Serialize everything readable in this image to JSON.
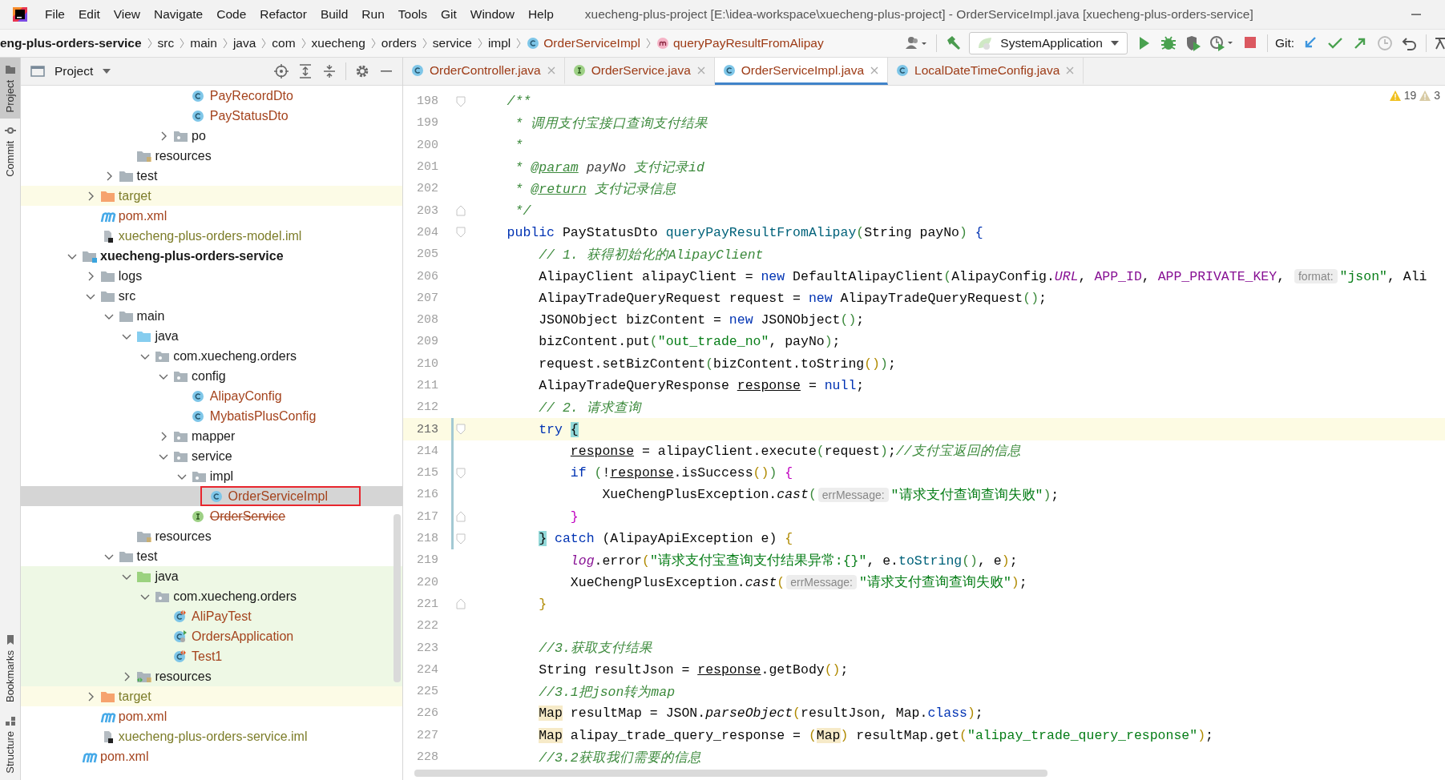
{
  "title_bar": {
    "menu": [
      "File",
      "Edit",
      "View",
      "Navigate",
      "Code",
      "Refactor",
      "Build",
      "Run",
      "Tools",
      "Git",
      "Window",
      "Help"
    ],
    "title": "xuecheng-plus-project [E:\\idea-workspace\\xuecheng-plus-project] - OrderServiceImpl.java [xuecheng-plus-orders-service]"
  },
  "breadcrumbs": [
    {
      "label": "eng-plus-orders-service",
      "kind": "module"
    },
    {
      "label": "src",
      "kind": "folder"
    },
    {
      "label": "main",
      "kind": "folder"
    },
    {
      "label": "java",
      "kind": "folder"
    },
    {
      "label": "com",
      "kind": "folder"
    },
    {
      "label": "xuecheng",
      "kind": "folder"
    },
    {
      "label": "orders",
      "kind": "folder"
    },
    {
      "label": "service",
      "kind": "folder"
    },
    {
      "label": "impl",
      "kind": "folder"
    },
    {
      "label": "OrderServiceImpl",
      "kind": "class"
    },
    {
      "label": "queryPayResultFromAlipay",
      "kind": "method"
    }
  ],
  "toolbar": {
    "run_config": "SystemApplication",
    "git_label": "Git:"
  },
  "tool_strip": {
    "top": [
      {
        "label": "Project",
        "selected": true
      },
      {
        "label": "Commit",
        "selected": false
      }
    ],
    "bottom": [
      {
        "label": "Bookmarks",
        "selected": false
      },
      {
        "label": "Structure",
        "selected": false
      }
    ]
  },
  "project": {
    "title": "Project",
    "tree": [
      {
        "children": [
          {
            "children": [
              {
                "children": [
                  {
                    "children": [
                      {
                        "children": [
                          {
                            "children": [
                              {
                                "label": "PayRecordDto",
                                "kind": "class",
                                "color": "#a4431d",
                                "selected": false
                              },
                              {
                                "label": "PayStatusDto",
                                "kind": "class",
                                "color": "#a4431d",
                                "selected": false
                              }
                            ]
                          },
                          {
                            "label": "po",
                            "kind": "package",
                            "expanded": false,
                            "selected": false
                          }
                        ]
                      }
                    ]
                  },
                  {
                    "label": "resources",
                    "kind": "resources",
                    "selected": false
                  }
                ]
              },
              {
                "label": "test",
                "kind": "folder",
                "expanded": false,
                "selected": false
              }
            ]
          },
          {
            "label": "target",
            "kind": "excluded",
            "color": "#7d7d2a",
            "expanded": false,
            "selected": false
          },
          {
            "label": "pom.xml",
            "kind": "maven",
            "color": "#a4431d",
            "selected": false
          },
          {
            "label": "xuecheng-plus-orders-model.iml",
            "kind": "iml",
            "color": "#7d7d2a",
            "selected": false
          }
        ]
      },
      {
        "label": "xuecheng-plus-orders-service",
        "kind": "module",
        "expanded": true,
        "selected": false,
        "children": [
          {
            "label": "logs",
            "kind": "folder",
            "expanded": false,
            "selected": false
          },
          {
            "label": "src",
            "kind": "folder",
            "expanded": true,
            "selected": false,
            "children": [
              {
                "label": "main",
                "kind": "folder",
                "expanded": true,
                "selected": false,
                "children": [
                  {
                    "label": "java",
                    "kind": "source-root",
                    "expanded": true,
                    "selected": false,
                    "children": [
                      {
                        "label": "com.xuecheng.orders",
                        "kind": "package",
                        "expanded": true,
                        "selected": false,
                        "children": [
                          {
                            "label": "config",
                            "kind": "package",
                            "expanded": true,
                            "selected": false,
                            "children": [
                              {
                                "label": "AlipayConfig",
                                "kind": "class",
                                "color": "#a4431d",
                                "selected": false
                              },
                              {
                                "label": "MybatisPlusConfig",
                                "kind": "class",
                                "color": "#a4431d",
                                "selected": false
                              }
                            ]
                          },
                          {
                            "label": "mapper",
                            "kind": "package",
                            "expanded": false,
                            "selected": false
                          },
                          {
                            "label": "service",
                            "kind": "package",
                            "expanded": true,
                            "selected": false,
                            "children": [
                              {
                                "label": "impl",
                                "kind": "package",
                                "expanded": true,
                                "selected": false,
                                "children": [
                                  {
                                    "label": "OrderServiceImpl",
                                    "kind": "class",
                                    "color": "#a4431d",
                                    "selected": true,
                                    "marked": true
                                  }
                                ]
                              },
                              {
                                "label": "OrderService",
                                "kind": "interface",
                                "color": "#a4431d",
                                "deprecated": true,
                                "selected": false
                              }
                            ]
                          }
                        ]
                      }
                    ]
                  },
                  {
                    "label": "resources",
                    "kind": "resources",
                    "selected": false
                  }
                ]
              },
              {
                "label": "test",
                "kind": "folder",
                "expanded": true,
                "selected": false,
                "children": [
                  {
                    "label": "java",
                    "kind": "test-root",
                    "expanded": true,
                    "selected": false,
                    "children": [
                      {
                        "label": "com.xuecheng.orders",
                        "kind": "package",
                        "expanded": true,
                        "selected": false,
                        "children": [
                          {
                            "label": "AliPayTest",
                            "kind": "test-class",
                            "color": "#a4431d",
                            "selected": false
                          },
                          {
                            "label": "OrdersApplication",
                            "kind": "app-class",
                            "color": "#a4431d",
                            "selected": false
                          },
                          {
                            "label": "Test1",
                            "kind": "test-class",
                            "color": "#a4431d",
                            "selected": false
                          }
                        ]
                      }
                    ]
                  },
                  {
                    "label": "resources",
                    "kind": "test-resources",
                    "expanded": false,
                    "selected": false
                  }
                ]
              }
            ]
          },
          {
            "label": "target",
            "kind": "excluded",
            "color": "#7d7d2a",
            "expanded": false,
            "selected": false
          },
          {
            "label": "pom.xml",
            "kind": "maven",
            "color": "#a4431d",
            "selected": false
          },
          {
            "label": "xuecheng-plus-orders-service.iml",
            "kind": "iml",
            "color": "#7d7d2a",
            "selected": false
          }
        ]
      },
      {
        "label": "pom.xml",
        "kind": "maven",
        "color": "#a4431d",
        "selected": false
      }
    ]
  },
  "tabs": [
    {
      "label": "OrderController.java",
      "kind": "class",
      "selected": false
    },
    {
      "label": "OrderService.java",
      "kind": "interface",
      "selected": false
    },
    {
      "label": "OrderServiceImpl.java",
      "kind": "class",
      "selected": true
    },
    {
      "label": "LocalDateTimeConfig.java",
      "kind": "class",
      "selected": false
    }
  ],
  "editor": {
    "warnings": "19",
    "weak_warnings": "3",
    "lines": [
      {
        "number": "198",
        "fold_start": true,
        "current": false,
        "tokens": [
          {
            "kind": "doc",
            "text": "    /**"
          }
        ]
      },
      {
        "number": "199",
        "current": false,
        "tokens": [
          {
            "kind": "doc",
            "text": "     * 调用支付宝接口查询支付结果"
          }
        ]
      },
      {
        "number": "200",
        "current": false,
        "tokens": [
          {
            "kind": "doc",
            "text": "     *"
          }
        ]
      },
      {
        "number": "201",
        "current": false,
        "tokens": [
          {
            "kind": "doc",
            "text": "     * "
          },
          {
            "kind": "doctag",
            "text": "@param"
          },
          {
            "kind": "docref",
            "text": " payNo"
          },
          {
            "kind": "doc",
            "text": " 支付记录id"
          }
        ]
      },
      {
        "number": "202",
        "current": false,
        "tokens": [
          {
            "kind": "doc",
            "text": "     * "
          },
          {
            "kind": "doctag",
            "text": "@return"
          },
          {
            "kind": "doc",
            "text": " 支付记录信息"
          }
        ]
      },
      {
        "number": "203",
        "fold_end": true,
        "current": false,
        "tokens": [
          {
            "kind": "doc",
            "text": "     */"
          }
        ]
      },
      {
        "number": "204",
        "fold_start": true,
        "current": false,
        "tokens": [
          {
            "kind": "kw",
            "text": "    public "
          },
          {
            "kind": "plain",
            "text": "PayStatusDto "
          },
          {
            "kind": "decl",
            "text": "queryPayResultFromAlipay"
          },
          {
            "kind": "rb-green",
            "text": "("
          },
          {
            "kind": "plain",
            "text": "String payNo"
          },
          {
            "kind": "rb-green",
            "text": ")"
          },
          {
            "kind": "rb-blue",
            "text": " {"
          }
        ]
      },
      {
        "number": "205",
        "current": false,
        "tokens": [
          {
            "kind": "comment",
            "text": "        // 1. 获得初始化的AlipayClient"
          }
        ]
      },
      {
        "number": "206",
        "current": false,
        "tokens": [
          {
            "kind": "plain",
            "text": "        AlipayClient alipayClient = "
          },
          {
            "kind": "kw",
            "text": "new "
          },
          {
            "kind": "plain",
            "text": "DefaultAlipayClient"
          },
          {
            "kind": "rb-green",
            "text": "("
          },
          {
            "kind": "plain",
            "text": "AlipayConfig."
          },
          {
            "kind": "const-i",
            "text": "URL"
          },
          {
            "kind": "plain",
            "text": ", "
          },
          {
            "kind": "const",
            "text": "APP_ID"
          },
          {
            "kind": "plain",
            "text": ", "
          },
          {
            "kind": "const",
            "text": "APP_PRIVATE_KEY"
          },
          {
            "kind": "plain",
            "text": ", "
          },
          {
            "kind": "hint",
            "text": "format:"
          },
          {
            "kind": "string",
            "text": "\"json\""
          },
          {
            "kind": "plain",
            "text": ", Ali"
          }
        ]
      },
      {
        "number": "207",
        "current": false,
        "tokens": [
          {
            "kind": "plain",
            "text": "        AlipayTradeQueryRequest request = "
          },
          {
            "kind": "kw",
            "text": "new "
          },
          {
            "kind": "plain",
            "text": "AlipayTradeQueryRequest"
          },
          {
            "kind": "rb-green",
            "text": "()"
          },
          {
            "kind": "plain",
            "text": ";"
          }
        ]
      },
      {
        "number": "208",
        "current": false,
        "tokens": [
          {
            "kind": "plain",
            "text": "        JSONObject bizContent = "
          },
          {
            "kind": "kw",
            "text": "new "
          },
          {
            "kind": "plain",
            "text": "JSONObject"
          },
          {
            "kind": "rb-green",
            "text": "()"
          },
          {
            "kind": "plain",
            "text": ";"
          }
        ]
      },
      {
        "number": "209",
        "current": false,
        "tokens": [
          {
            "kind": "plain",
            "text": "        bizContent.put"
          },
          {
            "kind": "rb-green",
            "text": "("
          },
          {
            "kind": "string",
            "text": "\"out_trade_no\""
          },
          {
            "kind": "plain",
            "text": ", payNo"
          },
          {
            "kind": "rb-green",
            "text": ")"
          },
          {
            "kind": "plain",
            "text": ";"
          }
        ]
      },
      {
        "number": "210",
        "current": false,
        "tokens": [
          {
            "kind": "plain",
            "text": "        request.setBizContent"
          },
          {
            "kind": "rb-green",
            "text": "("
          },
          {
            "kind": "plain",
            "text": "bizContent.toString"
          },
          {
            "kind": "rb-gold",
            "text": "()"
          },
          {
            "kind": "rb-green",
            "text": ")"
          },
          {
            "kind": "plain",
            "text": ";"
          }
        ]
      },
      {
        "number": "211",
        "current": false,
        "tokens": [
          {
            "kind": "plain",
            "text": "        AlipayTradeQueryResponse "
          },
          {
            "kind": "ul",
            "text": "response"
          },
          {
            "kind": "plain",
            "text": " = "
          },
          {
            "kind": "kw",
            "text": "null"
          },
          {
            "kind": "plain",
            "text": ";"
          }
        ]
      },
      {
        "number": "212",
        "current": false,
        "tokens": [
          {
            "kind": "comment",
            "text": "        // 2. 请求查询"
          }
        ]
      },
      {
        "number": "213",
        "fold_start": true,
        "current": true,
        "changed": true,
        "tokens": [
          {
            "kind": "kw",
            "text": "        try "
          },
          {
            "kind": "match",
            "text": "{"
          }
        ]
      },
      {
        "number": "214",
        "current": false,
        "changed": true,
        "tokens": [
          {
            "kind": "ul",
            "text": "            response"
          },
          {
            "kind": "plain",
            "text": " = alipayClient.execute"
          },
          {
            "kind": "rb-green",
            "text": "("
          },
          {
            "kind": "plain",
            "text": "request"
          },
          {
            "kind": "rb-green",
            "text": ")"
          },
          {
            "kind": "plain",
            "text": ";"
          },
          {
            "kind": "comment",
            "text": "//支付宝返回的信息"
          }
        ]
      },
      {
        "number": "215",
        "fold_start": true,
        "current": false,
        "changed": true,
        "tokens": [
          {
            "kind": "kw",
            "text": "            if "
          },
          {
            "kind": "rb-green",
            "text": "("
          },
          {
            "kind": "plain",
            "text": "!"
          },
          {
            "kind": "ul",
            "text": "response"
          },
          {
            "kind": "plain",
            "text": ".isSuccess"
          },
          {
            "kind": "rb-gold",
            "text": "()"
          },
          {
            "kind": "rb-green",
            "text": ")"
          },
          {
            "kind": "rb-magenta",
            "text": " {"
          }
        ]
      },
      {
        "number": "216",
        "current": false,
        "changed": true,
        "tokens": [
          {
            "kind": "plain",
            "text": "                XueChengPlusException."
          },
          {
            "kind": "static",
            "text": "cast"
          },
          {
            "kind": "rb-green",
            "text": "("
          },
          {
            "kind": "hint",
            "text": "errMessage:"
          },
          {
            "kind": "string",
            "text": "\"请求支付查询查询失败\""
          },
          {
            "kind": "rb-green",
            "text": ")"
          },
          {
            "kind": "plain",
            "text": ";"
          }
        ]
      },
      {
        "number": "217",
        "fold_end": true,
        "current": false,
        "changed": true,
        "tokens": [
          {
            "kind": "rb-magenta",
            "text": "            }"
          }
        ]
      },
      {
        "number": "218",
        "fold_start": true,
        "current": false,
        "changed": true,
        "tokens": [
          {
            "kind": "match",
            "text": "        }"
          },
          {
            "kind": "kw",
            "text": " catch "
          },
          {
            "kind": "plain",
            "text": "(AlipayApiException e) "
          },
          {
            "kind": "rb-gold",
            "text": "{"
          }
        ]
      },
      {
        "number": "219",
        "current": false,
        "tokens": [
          {
            "kind": "field",
            "text": "            log"
          },
          {
            "kind": "plain",
            "text": ".error"
          },
          {
            "kind": "rb-gold",
            "text": "("
          },
          {
            "kind": "string",
            "text": "\"请求支付宝查询支付结果异常:{}\""
          },
          {
            "kind": "plain",
            "text": ", e."
          },
          {
            "kind": "call",
            "text": "toString"
          },
          {
            "kind": "rb-green",
            "text": "()"
          },
          {
            "kind": "plain",
            "text": ", e"
          },
          {
            "kind": "rb-gold",
            "text": ")"
          },
          {
            "kind": "plain",
            "text": ";"
          }
        ]
      },
      {
        "number": "220",
        "current": false,
        "tokens": [
          {
            "kind": "plain",
            "text": "            XueChengPlusException."
          },
          {
            "kind": "static",
            "text": "cast"
          },
          {
            "kind": "rb-gold",
            "text": "("
          },
          {
            "kind": "hint",
            "text": "errMessage:"
          },
          {
            "kind": "string",
            "text": "\"请求支付查询查询失败\""
          },
          {
            "kind": "rb-gold",
            "text": ")"
          },
          {
            "kind": "plain",
            "text": ";"
          }
        ]
      },
      {
        "number": "221",
        "fold_end": true,
        "current": false,
        "tokens": [
          {
            "kind": "rb-gold",
            "text": "        }"
          }
        ]
      },
      {
        "number": "222",
        "current": false
      },
      {
        "number": "223",
        "current": false,
        "tokens": [
          {
            "kind": "comment",
            "text": "        //3.获取支付结果"
          }
        ]
      },
      {
        "number": "224",
        "current": false,
        "tokens": [
          {
            "kind": "plain",
            "text": "        String resultJson = "
          },
          {
            "kind": "ul",
            "text": "response"
          },
          {
            "kind": "plain",
            "text": ".getBody"
          },
          {
            "kind": "rb-gold",
            "text": "()"
          },
          {
            "kind": "plain",
            "text": ";"
          }
        ]
      },
      {
        "number": "225",
        "current": false,
        "tokens": [
          {
            "kind": "comment",
            "text": "        //3.1把json转为map"
          }
        ]
      },
      {
        "number": "226",
        "current": false,
        "tokens": [
          {
            "kind": "usage",
            "text": "        Map"
          },
          {
            "kind": "plain",
            "text": " resultMap = JSON."
          },
          {
            "kind": "static",
            "text": "parseObject"
          },
          {
            "kind": "rb-gold",
            "text": "("
          },
          {
            "kind": "plain",
            "text": "resultJson, Map."
          },
          {
            "kind": "kw",
            "text": "class"
          },
          {
            "kind": "rb-gold",
            "text": ")"
          },
          {
            "kind": "plain",
            "text": ";"
          }
        ]
      },
      {
        "number": "227",
        "current": false,
        "tokens": [
          {
            "kind": "usage",
            "text": "        Map"
          },
          {
            "kind": "plain",
            "text": " alipay_trade_query_response = "
          },
          {
            "kind": "rb-gold",
            "text": "("
          },
          {
            "kind": "usage",
            "text": "Map"
          },
          {
            "kind": "rb-gold",
            "text": ")"
          },
          {
            "kind": "plain",
            "text": " resultMap.get"
          },
          {
            "kind": "rb-gold",
            "text": "("
          },
          {
            "kind": "string",
            "text": "\"alipay_trade_query_response\""
          },
          {
            "kind": "rb-gold",
            "text": ")"
          },
          {
            "kind": "plain",
            "text": ";"
          }
        ]
      },
      {
        "number": "228",
        "current": false,
        "tokens": [
          {
            "kind": "comment",
            "text": "        //3.2获取我们需要的信息"
          }
        ]
      }
    ]
  }
}
